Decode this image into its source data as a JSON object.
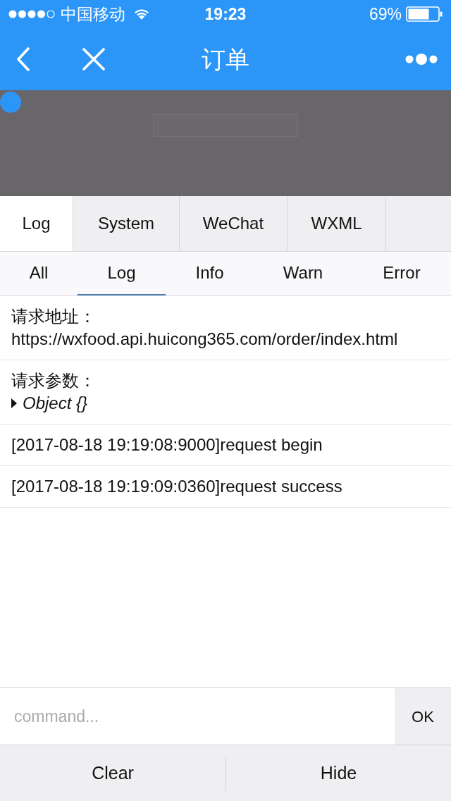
{
  "status_bar": {
    "carrier": "中国移动",
    "time": "19:23",
    "battery": "69%"
  },
  "nav_bar": {
    "title": "订单"
  },
  "panel_tabs": [
    {
      "label": "Log",
      "selected": true
    },
    {
      "label": "System",
      "selected": false
    },
    {
      "label": "WeChat",
      "selected": false
    },
    {
      "label": "WXML",
      "selected": false
    }
  ],
  "filters": [
    {
      "label": "All",
      "selected": false
    },
    {
      "label": "Log",
      "selected": true
    },
    {
      "label": "Info",
      "selected": false
    },
    {
      "label": "Warn",
      "selected": false
    },
    {
      "label": "Error",
      "selected": false
    }
  ],
  "log_entries": [
    {
      "kind": "request",
      "label": "请求地址：",
      "value": "https://wxfood.api.huicong365.com/order/index.html"
    },
    {
      "kind": "object",
      "label": "请求参数：",
      "value": "Object {}",
      "expanded": false
    },
    {
      "kind": "message",
      "text": "[2017-08-18 19:19:08:9000]request begin"
    },
    {
      "kind": "message",
      "text": "[2017-08-18 19:19:09:0360]request success"
    }
  ],
  "command": {
    "placeholder": "command...",
    "button": "OK"
  },
  "bottom_bar": [
    "Clear",
    "Hide"
  ]
}
